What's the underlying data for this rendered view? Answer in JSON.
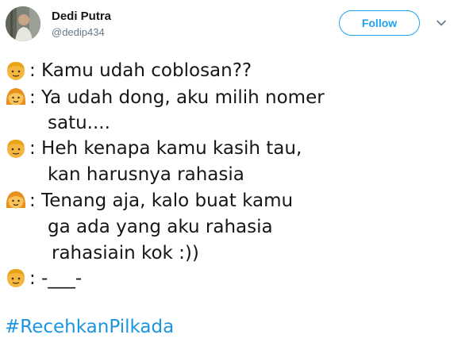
{
  "user": {
    "display_name": "Dedi Putra",
    "handle": "@dedip434"
  },
  "follow_label": "Follow",
  "tweet": {
    "lines": [
      {
        "emoji": "boy-emoji",
        "text": ": Kamu udah coblosan??"
      },
      {
        "emoji": "girl-emoji",
        "text": ": Ya udah dong, aku milih nomer"
      },
      {
        "emoji": null,
        "text": "satu...."
      },
      {
        "emoji": "boy-emoji",
        "text": ": Heh kenapa kamu kasih tau,"
      },
      {
        "emoji": null,
        "text": "kan harusnya rahasia"
      },
      {
        "emoji": "girl-emoji",
        "text": ": Tenang aja, kalo buat kamu"
      },
      {
        "emoji": null,
        "text": "ga ada yang aku rahasia"
      },
      {
        "emoji": null,
        "text": "rahasiain kok :))"
      },
      {
        "emoji": "boy-emoji",
        "text": ": -___-"
      }
    ],
    "hashtag": "#RecehkanPilkada"
  },
  "colors": {
    "accent": "#1da1f2",
    "hashtag": "#1b95e0",
    "text": "#14171a",
    "muted": "#657786"
  },
  "icons": {
    "more": "chevron-down-icon"
  }
}
